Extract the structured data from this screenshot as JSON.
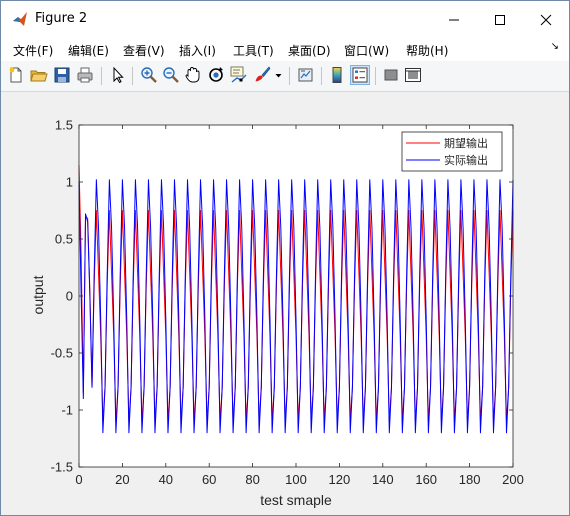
{
  "window": {
    "title": "Figure 2",
    "icon": "matlab-icon"
  },
  "window_buttons": [
    "minimize-icon",
    "maximize-icon",
    "close-icon"
  ],
  "menu": [
    "文件(F)",
    "编辑(E)",
    "查看(V)",
    "插入(I)",
    "工具(T)",
    "桌面(D)",
    "窗口(W)",
    "帮助(H)"
  ],
  "toolbar": [
    "new-figure-icon",
    "open-file-icon",
    "save-icon",
    "print-icon",
    "edit-plot-icon",
    "zoom-in-icon",
    "zoom-out-icon",
    "pan-icon",
    "rotate-3d-icon",
    "data-cursor-icon",
    "brush-icon",
    "brush-dropdown-icon",
    "link-plot-icon",
    "insert-colorbar-icon",
    "insert-legend-icon",
    "hide-plot-tools-icon",
    "show-plot-tools-icon"
  ],
  "chart_data": {
    "type": "line",
    "xlabel": "test smaple",
    "ylabel": "output",
    "xlim": [
      0,
      200
    ],
    "ylim": [
      -1.5,
      1.5
    ],
    "xticks": [
      "0",
      "20",
      "40",
      "60",
      "80",
      "100",
      "120",
      "140",
      "160",
      "180",
      "200"
    ],
    "yticks": [
      "1.5",
      "1",
      "0.5",
      "0",
      "-0.5",
      "-1",
      "-1.5"
    ],
    "grid": false,
    "legend_position": "top-right",
    "series": [
      {
        "name": "期望输出",
        "color": "#ff0000",
        "period": 6,
        "cycle_values": [
          -0.8,
          0.1,
          0.75,
          0.2,
          -0.35,
          -1.1
        ],
        "start": [
          1.15,
          0.35,
          -0.85,
          0.7,
          0.68,
          0.05
        ]
      },
      {
        "name": "实际输出",
        "color": "#0000ff",
        "period": 6,
        "cycle_values": [
          -0.8,
          0.2,
          1.02,
          0.6,
          -0.2,
          -1.2
        ],
        "start": [
          1.0,
          0.0,
          -0.9,
          0.72,
          0.65,
          0.0
        ]
      }
    ]
  }
}
